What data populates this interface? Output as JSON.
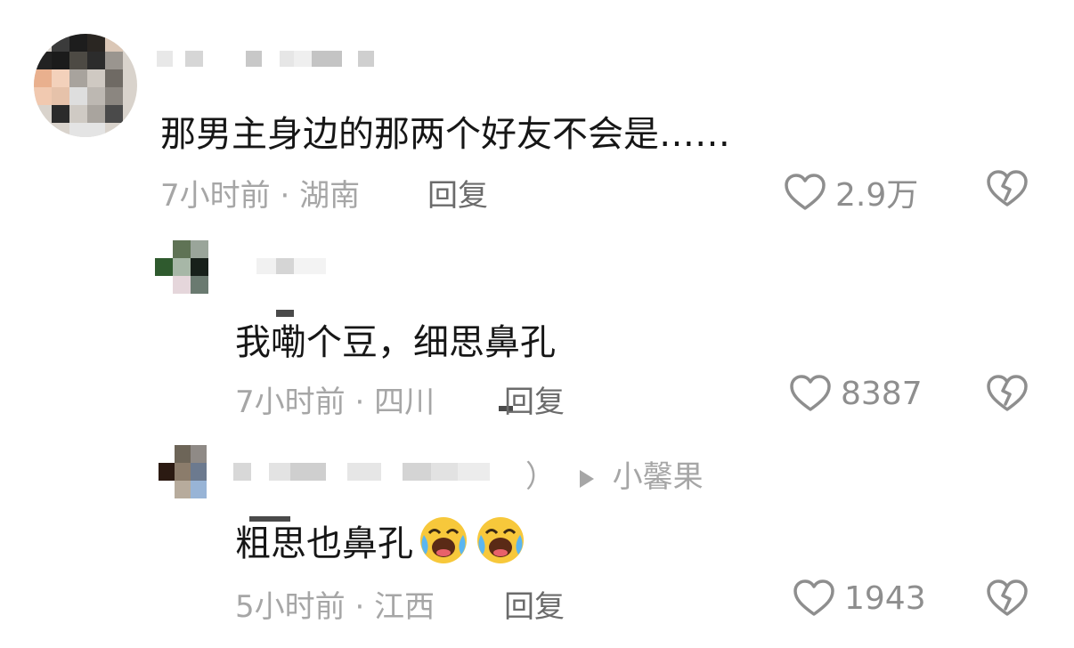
{
  "comments": [
    {
      "text": "那男主身边的那两个好友不会是……",
      "time": "7小时前",
      "location": "湖南",
      "reply_label": "回复",
      "likes": "2.9万"
    }
  ],
  "replies": [
    {
      "text": "我嘞个豆，细思鼻孔",
      "time": "7小时前",
      "location": "四川",
      "reply_label": "回复",
      "likes": "8387"
    },
    {
      "reply_to_suffix": "）",
      "reply_to_name": "小馨果",
      "text": "粗思也鼻孔",
      "emojis": [
        "crying-laughing-emoji",
        "crying-laughing-emoji"
      ],
      "time": "5小时前",
      "location": "江西",
      "reply_label": "回复",
      "likes": "1943"
    }
  ],
  "separator": "·",
  "icons": {
    "like": "heart-outline-icon",
    "dislike": "broken-heart-icon",
    "reply_arrow": "play-triangle-icon"
  },
  "colors": {
    "text": "#161616",
    "meta": "#a6a6a6",
    "reply": "#6b6b6b",
    "icon": "#8e8e8e"
  }
}
